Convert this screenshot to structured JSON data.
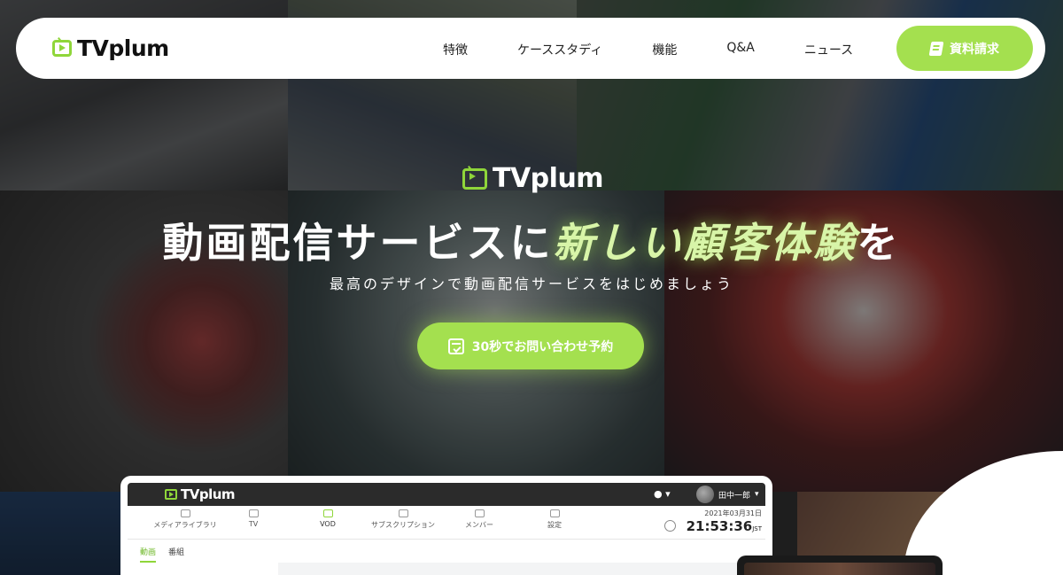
{
  "header": {
    "logo_text": "TVplum",
    "nav": [
      "特徴",
      "ケーススタディ",
      "機能",
      "Q&A",
      "ニュース"
    ],
    "cta_label": "資料請求",
    "cta_icon": "book-icon"
  },
  "hero": {
    "logo_text": "TVplum",
    "headline_plain": "動画配信サービスに",
    "headline_accent": "新しい顧客体験",
    "headline_tail": "を",
    "subline": "最高のデザインで動画配信サービスをはじめましょう",
    "cta_label": "30秒でお問い合わせ予約",
    "cta_icon": "calendar-icon"
  },
  "mockup": {
    "logo_text": "TVplum",
    "user_name": "田中一郎",
    "nav": [
      {
        "label": "メディアライブラリ",
        "icon": "folder-icon"
      },
      {
        "label": "TV",
        "icon": "tv-icon"
      },
      {
        "label": "VOD",
        "icon": "play-icon"
      },
      {
        "label": "サブスクリプション",
        "icon": "card-icon"
      },
      {
        "label": "メンバー",
        "icon": "members-icon"
      },
      {
        "label": "設定",
        "icon": "gear-icon"
      }
    ],
    "date": "2021年03月31日",
    "time": "21:53:36",
    "tz": "JST",
    "tabs": [
      "動画",
      "番組"
    ]
  },
  "colors": {
    "accent": "#a4e04f",
    "accent_dark": "#8fd63a",
    "header_bg": "#ffffff"
  }
}
